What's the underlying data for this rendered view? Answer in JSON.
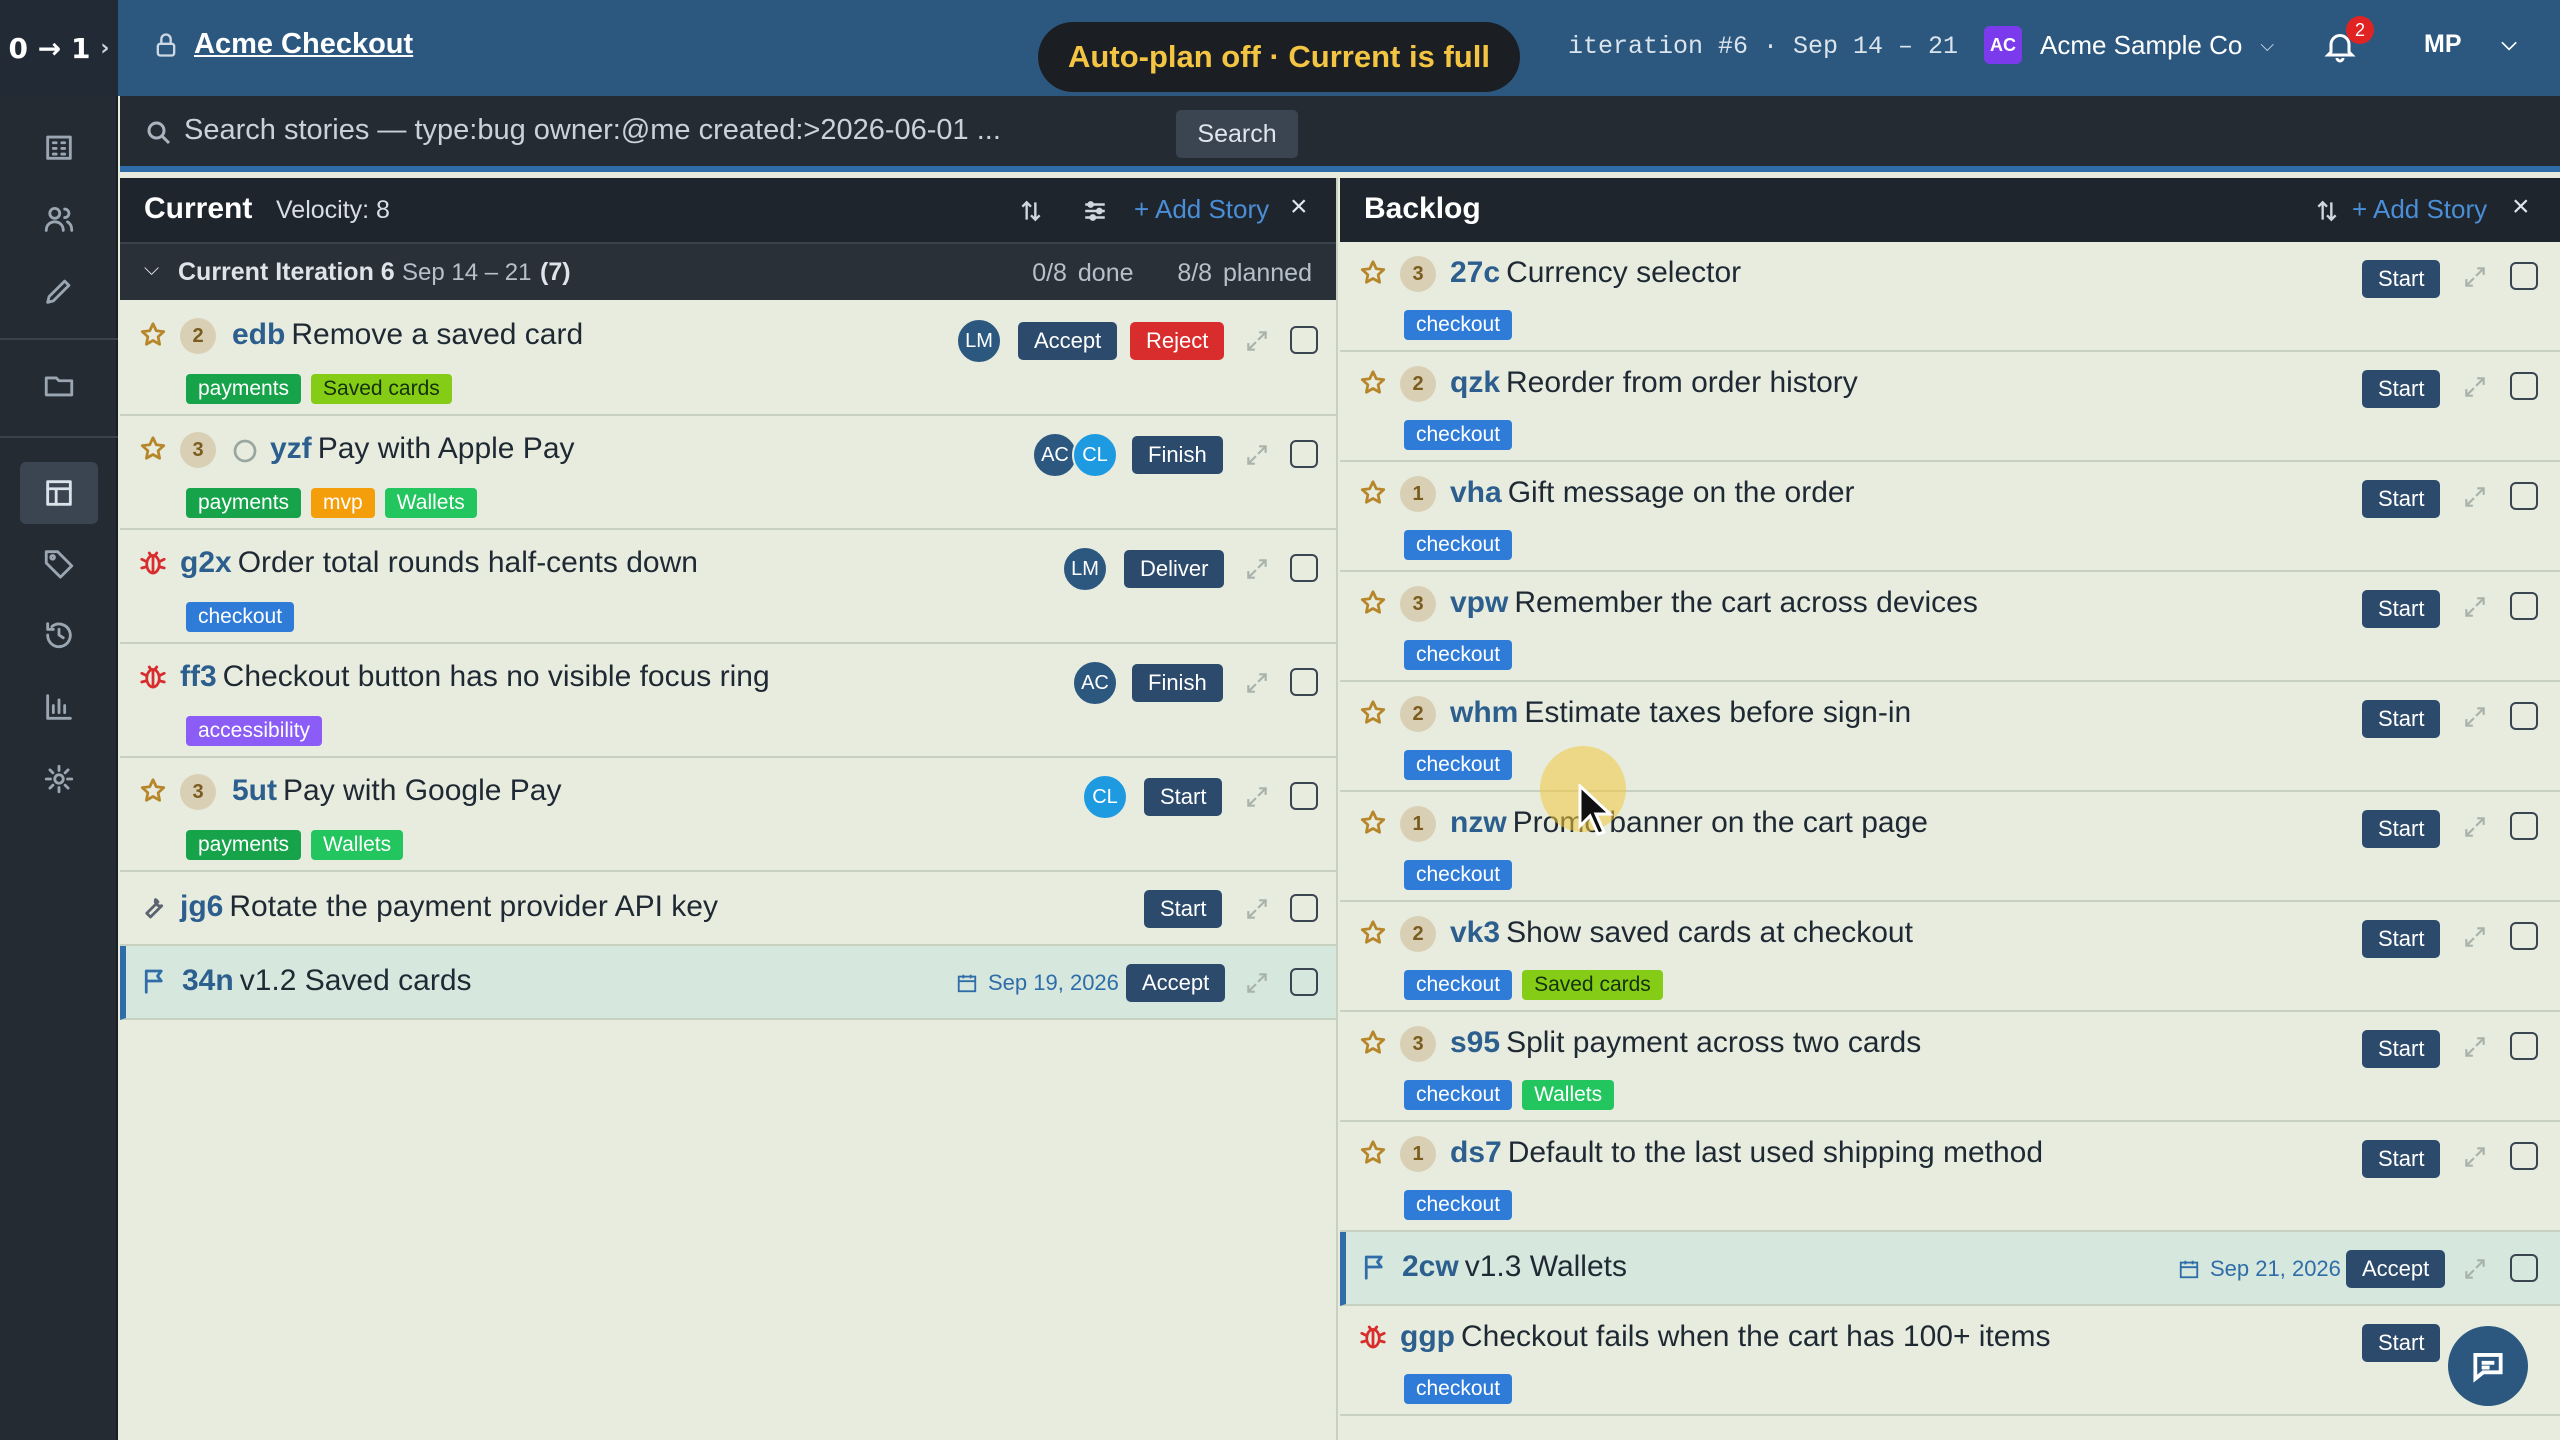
{
  "topbar": {
    "logo": "0 → 1",
    "project_name": "Acme Checkout",
    "toast": "Auto-plan off · Current is full",
    "iteration_info": "iteration #6 · Sep 14 – 21",
    "org_badge": "AC",
    "org_name": "Acme Sample Co",
    "notification_count": "2",
    "user_initials": "MP"
  },
  "search": {
    "placeholder": "Search stories — type:bug owner:@me created:>2026-06-01 ...",
    "button": "Search"
  },
  "current": {
    "title": "Current",
    "velocity": "Velocity: 8",
    "add_story": "+ Add Story",
    "iteration": {
      "title": "Current Iteration 6",
      "dates": "Sep 14 – 21",
      "count": "(7)",
      "done": "0/8 done",
      "planned": "8/8 planned"
    },
    "stories": [
      {
        "id": "edb",
        "title": "Remove a saved card",
        "estimate": "2",
        "labels": [
          "payments",
          "Saved cards"
        ],
        "owners": [
          "LM"
        ],
        "actions": [
          "Accept",
          "Reject"
        ]
      },
      {
        "id": "yzf",
        "title": "Pay with Apple Pay",
        "estimate": "3",
        "labels": [
          "payments",
          "mvp",
          "Wallets"
        ],
        "owners": [
          "AC",
          "CL"
        ],
        "actions": [
          "Finish"
        ]
      },
      {
        "id": "g2x",
        "title": "Order total rounds half-cents down",
        "labels": [
          "checkout"
        ],
        "owners": [
          "LM"
        ],
        "actions": [
          "Deliver"
        ]
      },
      {
        "id": "ff3",
        "title": "Checkout button has no visible focus ring",
        "labels": [
          "accessibility"
        ],
        "owners": [
          "AC"
        ],
        "actions": [
          "Finish"
        ]
      },
      {
        "id": "5ut",
        "title": "Pay with Google Pay",
        "estimate": "3",
        "labels": [
          "payments",
          "Wallets"
        ],
        "owners": [
          "CL"
        ],
        "actions": [
          "Start"
        ]
      },
      {
        "id": "jg6",
        "title": "Rotate the payment provider API key",
        "labels": [],
        "owners": [],
        "actions": [
          "Start"
        ]
      },
      {
        "id": "34n",
        "title": "v1.2 Saved cards",
        "date": "Sep 19, 2026",
        "actions": [
          "Accept"
        ]
      }
    ]
  },
  "backlog": {
    "title": "Backlog",
    "add_story": "+ Add Story",
    "stories": [
      {
        "id": "27c",
        "title": "Currency selector",
        "estimate": "3",
        "labels": [
          "checkout"
        ],
        "action": "Start"
      },
      {
        "id": "qzk",
        "title": "Reorder from order history",
        "estimate": "2",
        "labels": [
          "checkout"
        ],
        "action": "Start"
      },
      {
        "id": "vha",
        "title": "Gift message on the order",
        "estimate": "1",
        "labels": [
          "checkout"
        ],
        "action": "Start"
      },
      {
        "id": "vpw",
        "title": "Remember the cart across devices",
        "estimate": "3",
        "labels": [
          "checkout"
        ],
        "action": "Start"
      },
      {
        "id": "whm",
        "title": "Estimate taxes before sign-in",
        "estimate": "2",
        "labels": [
          "checkout"
        ],
        "action": "Start"
      },
      {
        "id": "nzw",
        "title": "Promo banner on the cart page",
        "estimate": "1",
        "labels": [
          "checkout"
        ],
        "action": "Start"
      },
      {
        "id": "vk3",
        "title": "Show saved cards at checkout",
        "estimate": "2",
        "labels": [
          "checkout",
          "Saved cards"
        ],
        "action": "Start"
      },
      {
        "id": "s95",
        "title": "Split payment across two cards",
        "estimate": "3",
        "labels": [
          "checkout",
          "Wallets"
        ],
        "action": "Start"
      },
      {
        "id": "ds7",
        "title": "Default to the last used shipping method",
        "estimate": "1",
        "labels": [
          "checkout"
        ],
        "action": "Start"
      },
      {
        "id": "2cw",
        "title": "v1.3 Wallets",
        "date": "Sep 21, 2026",
        "action": "Accept"
      },
      {
        "id": "ggp",
        "title": "Checkout fails when the cart has 100+ items",
        "labels": [
          "checkout"
        ],
        "action": "Start"
      }
    ]
  },
  "colors": {
    "topbar": "#2c5880",
    "accent": "#2f6da8",
    "reject": "#d92d2d",
    "toast_text": "#f4c542"
  }
}
